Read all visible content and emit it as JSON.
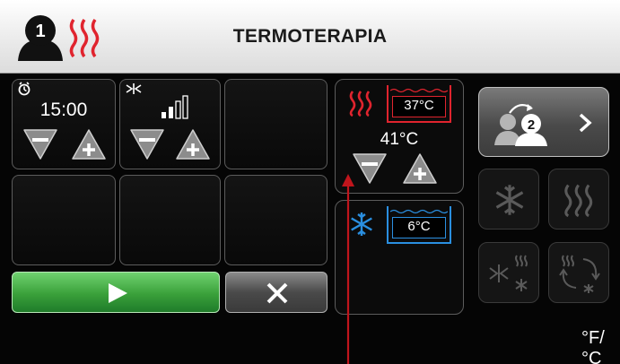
{
  "header": {
    "title": "TERMOTERAPIA",
    "user_number": "1"
  },
  "tiles": {
    "timer_value": "15:00",
    "intensity_symbol": "†‡"
  },
  "therapy": {
    "heat_box_temp": "37°C",
    "heat_setpoint": "41°C",
    "cold_box_temp": "6°C"
  },
  "next_user_number": "2",
  "units_label": "°F/°C",
  "colors": {
    "heat": "#e0242e",
    "cold": "#2a8fe0",
    "play": "#3aa03a",
    "annotation": "#c0151c"
  },
  "icons": [
    "user-icon",
    "heat-waves-icon",
    "timer-icon",
    "intensity-icon",
    "signal-bars-icon",
    "minus-icon",
    "plus-icon",
    "snowflake-icon",
    "play-icon",
    "close-icon",
    "next-user-icon",
    "chevron-right-icon",
    "cycle-icon",
    "contrast-icon"
  ]
}
